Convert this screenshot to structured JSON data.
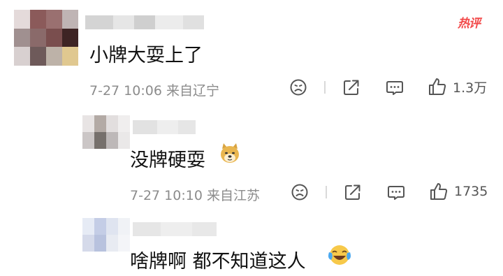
{
  "comments": [
    {
      "text": "小牌大耍上了",
      "meta": "7-27 10:06 来自辽宁",
      "badge": "热评",
      "like_count": "1.3万"
    },
    {
      "text": "没牌硬耍",
      "emoji": "doge-emoji",
      "meta": "7-27 10:10 来自江苏",
      "like_count": "1735"
    },
    {
      "text": "啥牌啊 都不知道这人",
      "emoji": "laugh-cry-emoji"
    }
  ],
  "icons": {
    "dislike": "sad-face-icon",
    "share": "share-icon",
    "reply": "comment-bubble-icon",
    "like": "thumbs-up-icon"
  },
  "colors": {
    "badge": "#f24a4a",
    "meta": "#8c8c8c",
    "icon": "#555555"
  }
}
